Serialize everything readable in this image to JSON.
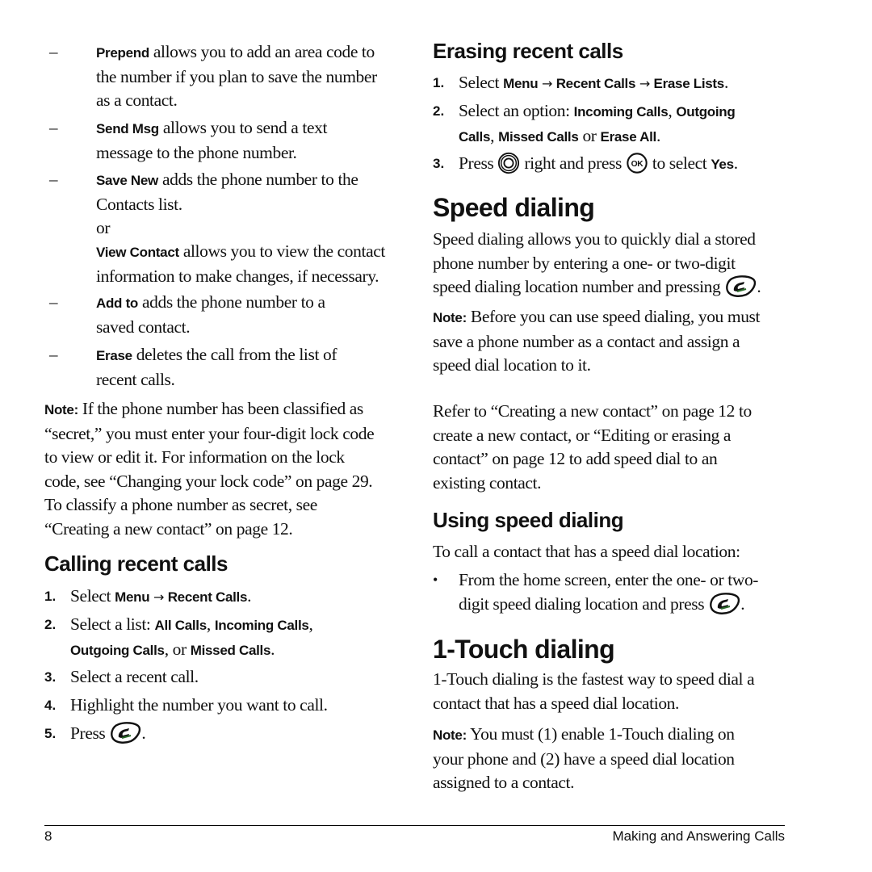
{
  "left": {
    "options": [
      {
        "term": "Prepend",
        "line1": " allows you to add an area code to",
        "rest": [
          "the number if you plan to save the number",
          "as a contact."
        ]
      },
      {
        "term": "Send Msg",
        "line1": " allows you to send a text",
        "rest": [
          "message to the phone number."
        ]
      },
      {
        "term": "Save New",
        "line1": " adds the phone number to the",
        "rest": [
          "Contacts list.",
          "or"
        ]
      },
      {
        "term": "View Contact",
        "line1": " allows you to view the contact",
        "rest": [
          "information to make changes, if necessary."
        ]
      },
      {
        "term": "Add to",
        "line1": " adds the phone number to a",
        "rest": [
          "saved contact."
        ]
      },
      {
        "term": "Erase",
        "line1": " deletes the call from the list of",
        "rest": [
          "recent calls."
        ]
      }
    ],
    "note": {
      "label": "Note:",
      "lines": [
        " If the phone number has been classified as",
        "“secret,” you must enter your four-digit lock code",
        "to view or edit it. For information on the lock",
        "code, see “Changing your lock code” on page 29.",
        "To classify a phone number as secret, see",
        "“Creating a new contact” on page 12."
      ]
    },
    "calling": {
      "heading": "Calling recent calls",
      "steps": [
        {
          "n": "1.",
          "select": "Select ",
          "menu": "Menu",
          "arrow": " → ",
          "target": "Recent Calls",
          "end": "."
        },
        {
          "n": "2.",
          "prefix": "Select a list: ",
          "opt1": "All Calls",
          "sep1": ", ",
          "opt2": "Incoming Calls",
          "sep2": ",",
          "opt3": "Outgoing Calls",
          "sep3": ", or ",
          "opt4": "Missed Calls",
          "end": "."
        },
        {
          "n": "3.",
          "text": "Select a recent call."
        },
        {
          "n": "4.",
          "text": "Highlight the number you want to call."
        },
        {
          "n": "5.",
          "text": "Press ",
          "icon": "send-key-icon",
          "end": "."
        }
      ]
    }
  },
  "right": {
    "erasing": {
      "heading": "Erasing recent calls",
      "steps": [
        {
          "n": "1.",
          "select": "Select ",
          "menu": "Menu",
          "arrow1": " → ",
          "item": "Recent Calls",
          "arrow2": " → ",
          "target": "Erase Lists",
          "end": "."
        },
        {
          "n": "2.",
          "prefix": "Select an option: ",
          "opt1": "Incoming Calls",
          "sep1": ", ",
          "opt2": "Outgoing",
          "opt2b": "Calls",
          "sep2": ", ",
          "opt3": "Missed Calls",
          "sep3": " or ",
          "opt4": "Erase All",
          "end": "."
        },
        {
          "n": "3.",
          "press": "Press ",
          "mid": " right and press ",
          "tail": " to select ",
          "yes": "Yes",
          "end": "."
        }
      ]
    },
    "speed": {
      "heading": "Speed dialing",
      "intro": [
        "Speed dialing allows you to quickly dial a stored",
        "phone number by entering a one- or two-digit",
        "speed dialing location number and pressing "
      ],
      "intro_end": ".",
      "note_label": "Note:",
      "note": [
        " Before you can use speed dialing, you must",
        "save a phone number as a contact and assign a",
        "speed dial location to it."
      ],
      "refer": [
        "Refer to “Creating a new contact” on page 12 to",
        "create a new contact, or “Editing or erasing a",
        "contact” on page 12 to add speed dial to an",
        "existing contact."
      ]
    },
    "using": {
      "heading": "Using speed dialing",
      "intro": "To call a contact that has a speed dial location:",
      "bullet": "•",
      "bullet_lines": [
        "From the home screen, enter the one- or two-",
        "digit speed dialing location and press "
      ],
      "bullet_end": "."
    },
    "touch": {
      "heading": "1-Touch dialing",
      "intro": [
        "1-Touch dialing is the fastest way to speed dial a",
        "contact that has a speed dial location."
      ],
      "note_label": "Note:",
      "note": [
        " You must (1) enable 1-Touch dialing on",
        "your phone and (2) have a speed dial location",
        "assigned to a contact."
      ]
    }
  },
  "footer": {
    "page_number": "8",
    "chapter": "Making and Answering Calls"
  }
}
